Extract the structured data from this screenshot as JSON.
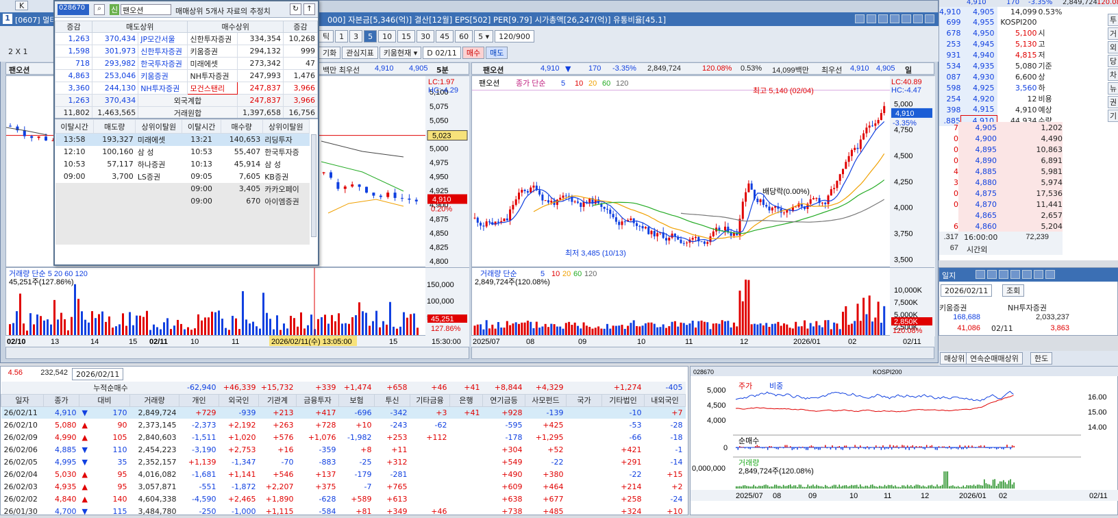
{
  "main_title": {
    "badge": "1",
    "text": "[0607] 멀티",
    "info": "000] 자본금[5,346(억)] 결산[12월] EPS[502] PER[9.79] 시가총액[26,247(억)] 유통비율[45.1]"
  },
  "popup": {
    "code": "028670",
    "stock_name": "팬오션",
    "tab_label": "신",
    "title": "매매상위 5개사 자료의 추정치",
    "headers": [
      "증감",
      "매도상위",
      "",
      "매수상위",
      "",
      "증감"
    ],
    "rows": [
      {
        "chg1": "1,263",
        "sell_qty": "370,434",
        "sell_name": "JP모간서울",
        "buy_name": "신한투자증권",
        "buy_qty": "334,354",
        "chg2": "10,268"
      },
      {
        "chg1": "1,598",
        "sell_qty": "301,973",
        "sell_name": "신한투자증권",
        "buy_name": "키움증권",
        "buy_qty": "294,132",
        "chg2": "999"
      },
      {
        "chg1": "718",
        "sell_qty": "293,982",
        "sell_name": "한국투자증권",
        "buy_name": "미래에셋",
        "buy_qty": "273,342",
        "chg2": "47"
      },
      {
        "chg1": "4,863",
        "sell_qty": "253,046",
        "sell_name": "키움증권",
        "buy_name": "NH투자증권",
        "buy_qty": "247,993",
        "chg2": "1,476"
      },
      {
        "chg1": "3,360",
        "sell_qty": "244,130",
        "sell_name": "NH투자증권",
        "buy_name": "모건스탠리",
        "buy_qty": "247,837",
        "chg2": "3,966"
      }
    ],
    "foreign": {
      "label": "외국계합",
      "chg1": "1,263",
      "sell_qty": "370,434",
      "buy_qty": "247,837",
      "chg2": "3,966"
    },
    "total": {
      "label": "거래원합",
      "chg1": "11,802",
      "sell_qty": "1,463,565",
      "buy_qty": "1,397,658",
      "chg2": "16,756"
    },
    "dev_headers": [
      "이탈시간",
      "매도량",
      "상위이탈원",
      "이탈시간",
      "매수량",
      "상위이탈원"
    ],
    "dev_rows": [
      [
        "13:58",
        "193,327",
        "미래에셋",
        "13:21",
        "140,653",
        "리딩투자"
      ],
      [
        "12:10",
        "100,160",
        "삼  성",
        "10:53",
        "55,407",
        "한국투자증"
      ],
      [
        "10:53",
        "57,117",
        "하나증권",
        "10:13",
        "45,914",
        "삼  성"
      ],
      [
        "09:00",
        "3,700",
        "LS증권",
        "09:05",
        "7,605",
        "KB증권"
      ],
      [
        "",
        "",
        "",
        "09:00",
        "3,405",
        "카카오페이"
      ],
      [
        "",
        "",
        "",
        "09:00",
        "670",
        "아이엠증권"
      ]
    ]
  },
  "left_chart": {
    "name": "팬오션",
    "period": "5분",
    "hdr": "백만 최우선",
    "bid": "4,910",
    "ask": "4,905",
    "lc": "LC:1.97",
    "hc": "HC:-4.29",
    "y_labels": [
      "5,100",
      "5,075",
      "5,050",
      "5,025",
      "5,000",
      "4,975",
      "4,950",
      "4,925",
      "4,900",
      "4,875",
      "4,850",
      "4,825",
      "4,800"
    ],
    "cur_price": "4,910",
    "cur_pct": "0.20%",
    "crosshair_price": "5,023",
    "vol_label": "거래량 단순 5 20 60 120",
    "vol_val": "45,251주(127.86%)",
    "vol_y": [
      "150,000",
      "100,000",
      "50,000"
    ],
    "vol_cur": "45,251",
    "vol_pct": "127.86%",
    "x_labels": [
      "02/10",
      "13",
      "14",
      "15",
      "02/11",
      "10",
      "11",
      "15"
    ],
    "x_tip": "2026/02/11(수) 13:05:00",
    "time_end": "15:30:00"
  },
  "right_chart": {
    "name": "팬오션",
    "price": "4,910",
    "chg": "170",
    "pct": "-3.35%",
    "volume": "2,849,724",
    "vol_ratio": "120.08%",
    "turn": "0.53%",
    "amount": "14,099백만",
    "bid_label": "최우선",
    "bid": "4,910",
    "ask": "4,905",
    "period": "일",
    "legend_name": "팬오션",
    "legend_ma": "종가 단순",
    "ma": [
      "5",
      "10",
      "20",
      "60",
      "120"
    ],
    "lc": "LC:40.89",
    "hc": "HC:-4.47",
    "high_note": "최고 5,140 (02/04)",
    "low_note": "최저 3,485 (10/13)",
    "mid_note": "배당락(0.00%)",
    "y_labels": [
      "5,000",
      "4,750",
      "4,500",
      "4,250",
      "4,000",
      "3,750",
      "3,500"
    ],
    "cur_price": "4,910",
    "cur_pct": "-3.35%",
    "vol_label": "거래량 단순",
    "vol_val": "2,849,724주(120.08%)",
    "vol_y": [
      "10,000K",
      "7,500K",
      "5,000K",
      "2,500K"
    ],
    "vol_cur": "2,850K",
    "vol_pct": "120.08%",
    "x_labels": [
      "2025/07",
      "08",
      "09",
      "10",
      "11",
      "12",
      "2026/01",
      "02"
    ],
    "date_end": "02/11"
  },
  "right_panel": {
    "top_price": "4,910",
    "top_chg": "170",
    "top_pct": "-3.35%",
    "top_vol": "2,849,724",
    "top_ratio": "120.08",
    "quotes": [
      [
        "4,910",
        "4,905",
        "14,099",
        "0.53%"
      ],
      [
        "699",
        "4,955",
        "KOSPI200",
        ""
      ],
      [
        "678",
        "4,950",
        "5,100",
        "시"
      ],
      [
        "253",
        "4,945",
        "5,130",
        "고"
      ],
      [
        "931",
        "4,940",
        "4,815",
        "저"
      ],
      [
        "534",
        "4,935",
        "5,080",
        "기준"
      ],
      [
        "087",
        "4,930",
        "6,600",
        "상"
      ],
      [
        "598",
        "4,925",
        "3,560",
        "하"
      ],
      [
        "254",
        "4,920",
        "12",
        "비용"
      ],
      [
        "398",
        "4,915",
        "4,910",
        "예상"
      ],
      [
        ".885",
        "4,910",
        "44,934",
        "수량"
      ]
    ],
    "bids": [
      [
        "7",
        "4,905",
        "1,202"
      ],
      [
        "0",
        "4,900",
        "4,490"
      ],
      [
        "0",
        "4,895",
        "10,863"
      ],
      [
        "0",
        "4,890",
        "6,891"
      ],
      [
        "4",
        "4,885",
        "5,981"
      ],
      [
        "3",
        "4,880",
        "5,974"
      ],
      [
        "0",
        "4,875",
        "17,536"
      ],
      [
        "0",
        "4,870",
        "11,441"
      ],
      [
        "",
        "4,865",
        "2,657"
      ],
      [
        "6",
        "4,860",
        "5,204"
      ]
    ],
    "bottom": [
      ".317",
      "16:00:00",
      "72,239"
    ],
    "bottom2": [
      "67",
      "시간외"
    ],
    "side_tabs": [
      "투",
      "거",
      "외",
      "당",
      "차",
      "뉴",
      "권",
      "기"
    ]
  },
  "broker_panel": {
    "title": "일지",
    "date": "2026/02/11",
    "search": "조회",
    "col1": "키움증권",
    "col2": "NH투자증권",
    "v1": "168,688",
    "v2": "2,033,237",
    "r_date": "02/11",
    "r1": "41,086",
    "r2": "3,863"
  },
  "tabs_right": [
    "매상위",
    "연속순매매상위",
    "한도"
  ],
  "investor": {
    "left_val1": "4.56",
    "left_val2": "232,542",
    "date": "2026/02/11",
    "label": "누적순매수",
    "cum": [
      "-62,940",
      "+46,339",
      "+15,732",
      "+339",
      "+1,474",
      "+658",
      "+46",
      "+41",
      "+8,844",
      "+4,329",
      "",
      "+1,274",
      "-405"
    ],
    "headers": [
      "일자",
      "종가",
      "대비",
      "거래량",
      "개인",
      "외국인",
      "기관계",
      "금융투자",
      "보험",
      "투신",
      "기타금융",
      "은행",
      "연기금등",
      "사모펀드",
      "국가",
      "기타법인",
      "내외국인"
    ],
    "rows": [
      [
        "26/02/11",
        "4,910",
        "▼",
        "170",
        "2,849,724",
        "+729",
        "-939",
        "+213",
        "+417",
        "-696",
        "-342",
        "+3",
        "+41",
        "+928",
        "-139",
        "",
        "-10",
        "+7"
      ],
      [
        "26/02/10",
        "5,080",
        "▲",
        "90",
        "2,373,145",
        "-2,373",
        "+2,192",
        "+263",
        "+728",
        "+10",
        "-243",
        "-62",
        "",
        "-595",
        "+425",
        "",
        "-53",
        "-28"
      ],
      [
        "26/02/09",
        "4,990",
        "▲",
        "105",
        "2,840,603",
        "-1,511",
        "+1,020",
        "+576",
        "+1,076",
        "-1,982",
        "+253",
        "+112",
        "",
        "-178",
        "+1,295",
        "",
        "-66",
        "-18"
      ],
      [
        "26/02/06",
        "4,885",
        "▼",
        "110",
        "2,454,223",
        "-3,190",
        "+2,753",
        "+16",
        "-359",
        "+8",
        "+11",
        "",
        "",
        "+304",
        "+52",
        "",
        "+421",
        "-1"
      ],
      [
        "26/02/05",
        "4,995",
        "▼",
        "35",
        "2,352,157",
        "+1,139",
        "-1,347",
        "-70",
        "-883",
        "-25",
        "+312",
        "",
        "",
        "+549",
        "-22",
        "",
        "+291",
        "-14"
      ],
      [
        "26/02/04",
        "5,030",
        "▲",
        "95",
        "4,016,082",
        "-1,681",
        "+1,141",
        "+546",
        "+137",
        "-179",
        "-281",
        "",
        "",
        "+490",
        "+380",
        "",
        "-22",
        "+15"
      ],
      [
        "26/02/03",
        "4,935",
        "▲",
        "95",
        "3,057,871",
        "-551",
        "-1,872",
        "+2,207",
        "+375",
        "-7",
        "+765",
        "",
        "",
        "+609",
        "+464",
        "",
        "+214",
        "+2"
      ],
      [
        "26/02/02",
        "4,840",
        "▲",
        "140",
        "4,604,338",
        "-4,590",
        "+2,465",
        "+1,890",
        "-628",
        "+589",
        "+613",
        "",
        "",
        "+638",
        "+677",
        "",
        "+258",
        "-24"
      ],
      [
        "26/01/30",
        "4,700",
        "▼",
        "115",
        "3,484,780",
        "-250",
        "-1,000",
        "+1,115",
        "-584",
        "+81",
        "+349",
        "+46",
        "",
        "+738",
        "+485",
        "",
        "+324",
        "+10"
      ]
    ]
  },
  "mini_chart": {
    "code": "028670",
    "kospi": "KOSPI200",
    "legend1": "주가",
    "legend2": "비중",
    "y1": [
      "5,000",
      "4,500",
      "4,000"
    ],
    "y2": [
      "16.00",
      "15.00",
      "14.00"
    ],
    "net_label": "순매수",
    "net_zero": "0",
    "vol_label": "거래량",
    "vol_val": "2,849,724주(120.08%)",
    "vol_y": "0,000,000",
    "x": [
      "2025/07",
      "08",
      "09",
      "10",
      "11",
      "12",
      "2026/01",
      "02"
    ],
    "x_end": "02/11"
  }
}
